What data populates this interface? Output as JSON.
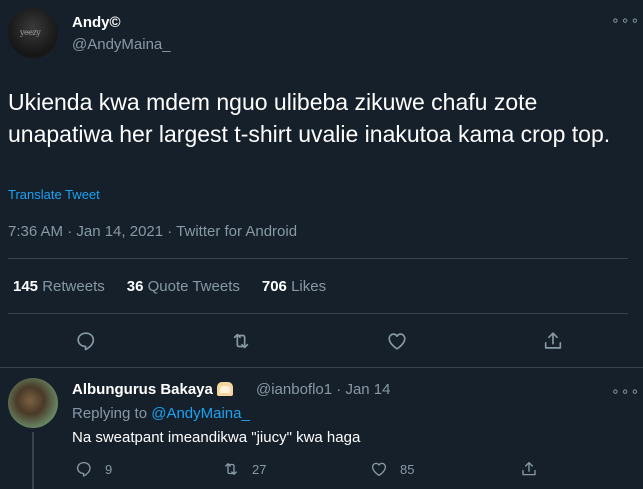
{
  "tweet": {
    "display_name": "Andy©",
    "handle": "@AndyMaina_",
    "more_icon": "more-horizontal-icon",
    "avatar_text": "yeezy",
    "text": "Ukienda kwa mdem nguo ulibeba zikuwe chafu zote unapatiwa her largest t-shirt uvalie inakutoa kama crop top.",
    "translate_label": "Translate Tweet",
    "meta": "7:36 AM · Jan 14, 2021 · Twitter for Android",
    "stats": {
      "retweets_count": "145",
      "retweets_label": "Retweets",
      "quotes_count": "36",
      "quotes_label": "Quote Tweets",
      "likes_count": "706",
      "likes_label": "Likes"
    }
  },
  "reply": {
    "display_name": "Albungurus Bakaya",
    "emoji_icon": "bread-icon",
    "handle_time": "@ianboflo1 · Jan 14",
    "replying_prefix": "Replying to",
    "replying_mention": "@AndyMaina_",
    "text": "Na sweatpant imeandikwa \"jiucy\" kwa haga",
    "reply_count": "9",
    "retweet_count": "27",
    "like_count": "85"
  },
  "colors": {
    "background": "#15202b",
    "secondary_text": "#8899a6",
    "accent": "#1da1f2",
    "divider": "#38444d"
  }
}
